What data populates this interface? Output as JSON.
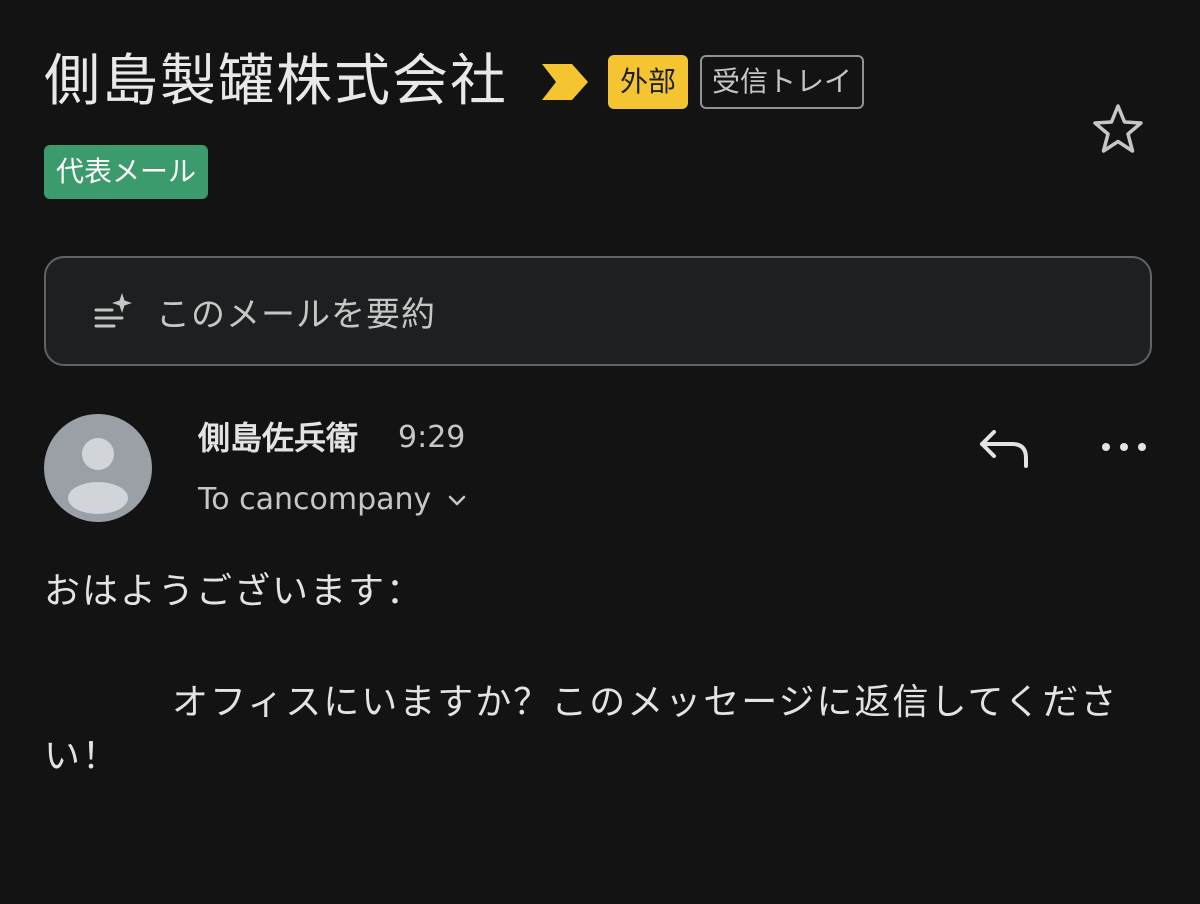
{
  "header": {
    "subject": "側島製罐株式会社",
    "badge_external": "外部",
    "badge_inbox": "受信トレイ",
    "label": "代表メール",
    "icons": {
      "importance": "importance-marker-icon",
      "star": "star-icon"
    }
  },
  "summary": {
    "label": "このメールを要約",
    "icon": "summarize-sparkle-icon"
  },
  "message": {
    "sender_name": "側島佐兵衛",
    "time": "9:29",
    "to": "To cancompany",
    "icons": {
      "reply": "reply-icon",
      "more": "more-icon",
      "expand": "chevron-down-icon"
    },
    "body_greeting": "おはようございます：",
    "body_text": "オフィスにいますか？このメッセージに返信してください！"
  },
  "colors": {
    "background": "#131314",
    "badge_external": "#f5c531",
    "label_green": "#3b9b6c",
    "importance_marker": "#f5c531"
  }
}
